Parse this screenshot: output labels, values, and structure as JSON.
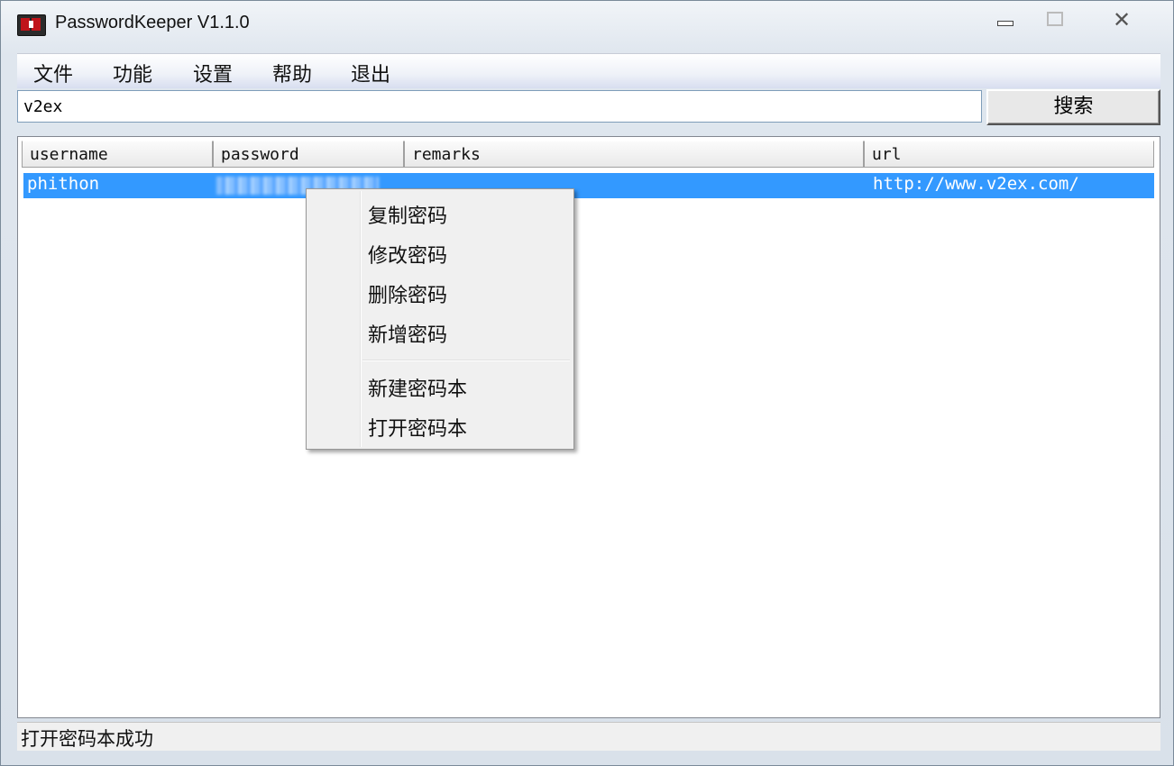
{
  "window": {
    "title": "PasswordKeeper V1.1.0",
    "close_glyph": "✕"
  },
  "menubar": {
    "items": [
      "文件",
      "功能",
      "设置",
      "帮助",
      "退出"
    ]
  },
  "search": {
    "value": "v2ex",
    "button_label": "搜索"
  },
  "table": {
    "columns": [
      "username",
      "password",
      "remarks",
      "url"
    ],
    "rows": [
      {
        "username": "phithon",
        "password": "",
        "remarks": "",
        "url": "http://www.v2ex.com/"
      }
    ]
  },
  "context_menu": {
    "group1": [
      "复制密码",
      "修改密码",
      "删除密码",
      "新增密码"
    ],
    "group2": [
      "新建密码本",
      "打开密码本"
    ]
  },
  "statusbar": {
    "text": "打开密码本成功"
  },
  "colors": {
    "selection": "#3399ff",
    "menu_bg": "#f0f0f0"
  }
}
